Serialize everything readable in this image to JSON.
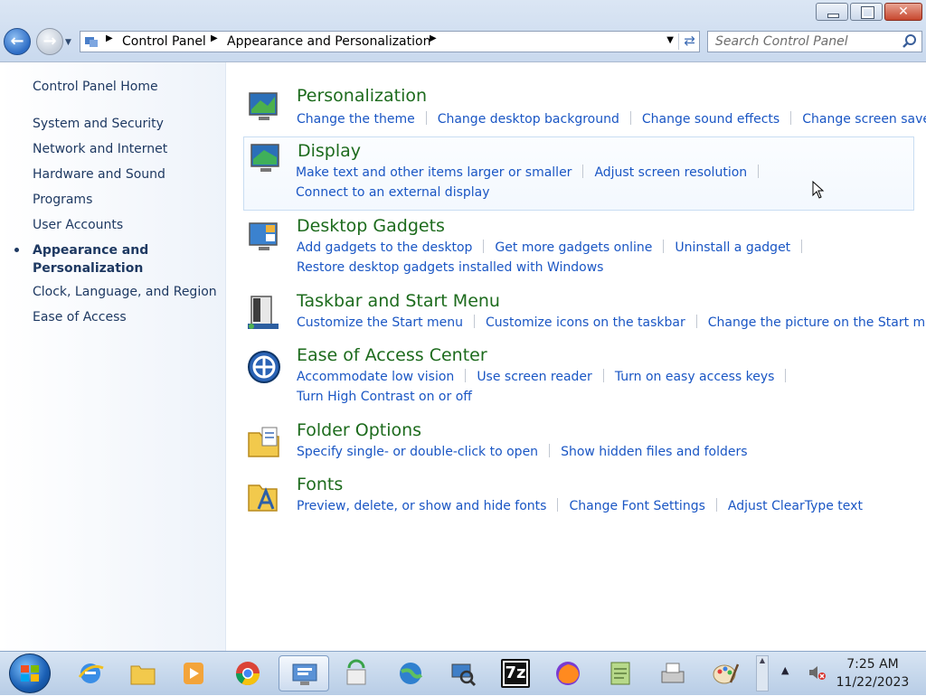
{
  "window": {
    "buttons": {
      "minimize": "minimize-icon",
      "maximize": "restore-icon",
      "close": "close-icon",
      "close_glyph": "✕"
    }
  },
  "address": {
    "crumbs": [
      "Control Panel",
      "Appearance and Personalization"
    ],
    "search_placeholder": "Search Control Panel"
  },
  "sidebar": {
    "home": "Control Panel Home",
    "items": [
      "System and Security",
      "Network and Internet",
      "Hardware and Sound",
      "Programs",
      "User Accounts",
      "Appearance and",
      "Clock, Language, and Region",
      "Ease of Access"
    ],
    "active_line2": "Personalization"
  },
  "categories": [
    {
      "title": "Personalization",
      "icon": "personalization-icon",
      "links": [
        "Change the theme",
        "Change desktop background",
        "Change sound effects",
        "Change screen saver"
      ]
    },
    {
      "title": "Display",
      "icon": "display-icon",
      "links": [
        "Make text and other items larger or smaller",
        "Adjust screen resolution",
        "Connect to an external display"
      ]
    },
    {
      "title": "Desktop Gadgets",
      "icon": "gadgets-icon",
      "links": [
        "Add gadgets to the desktop",
        "Get more gadgets online",
        "Uninstall a gadget",
        "Restore desktop gadgets installed with Windows"
      ]
    },
    {
      "title": "Taskbar and Start Menu",
      "icon": "taskbar-icon",
      "links": [
        "Customize the Start menu",
        "Customize icons on the taskbar",
        "Change the picture on the Start menu"
      ]
    },
    {
      "title": "Ease of Access Center",
      "icon": "ease-of-access-icon",
      "links": [
        "Accommodate low vision",
        "Use screen reader",
        "Turn on easy access keys",
        "Turn High Contrast on or off"
      ]
    },
    {
      "title": "Folder Options",
      "icon": "folder-options-icon",
      "links": [
        "Specify single- or double-click to open",
        "Show hidden files and folders"
      ]
    },
    {
      "title": "Fonts",
      "icon": "fonts-icon",
      "links": [
        "Preview, delete, or show and hide fonts",
        "Change Font Settings",
        "Adjust ClearType text"
      ]
    }
  ],
  "taskbar": {
    "apps": [
      "internet-explorer-icon",
      "file-explorer-icon",
      "media-player-icon",
      "chrome-icon",
      "control-panel-icon",
      "sync-icon",
      "network-globe-icon",
      "search-computer-icon",
      "seven-zip-icon",
      "firefox-icon",
      "notepad-icon",
      "fax-scan-icon",
      "paint-icon"
    ],
    "seven_zip_label": "7z",
    "time": "7:25 AM",
    "date": "11/22/2023"
  },
  "colors": {
    "link": "#1a56c4",
    "category_title": "#1d6b1d",
    "sidebar_text": "#1e3962"
  }
}
